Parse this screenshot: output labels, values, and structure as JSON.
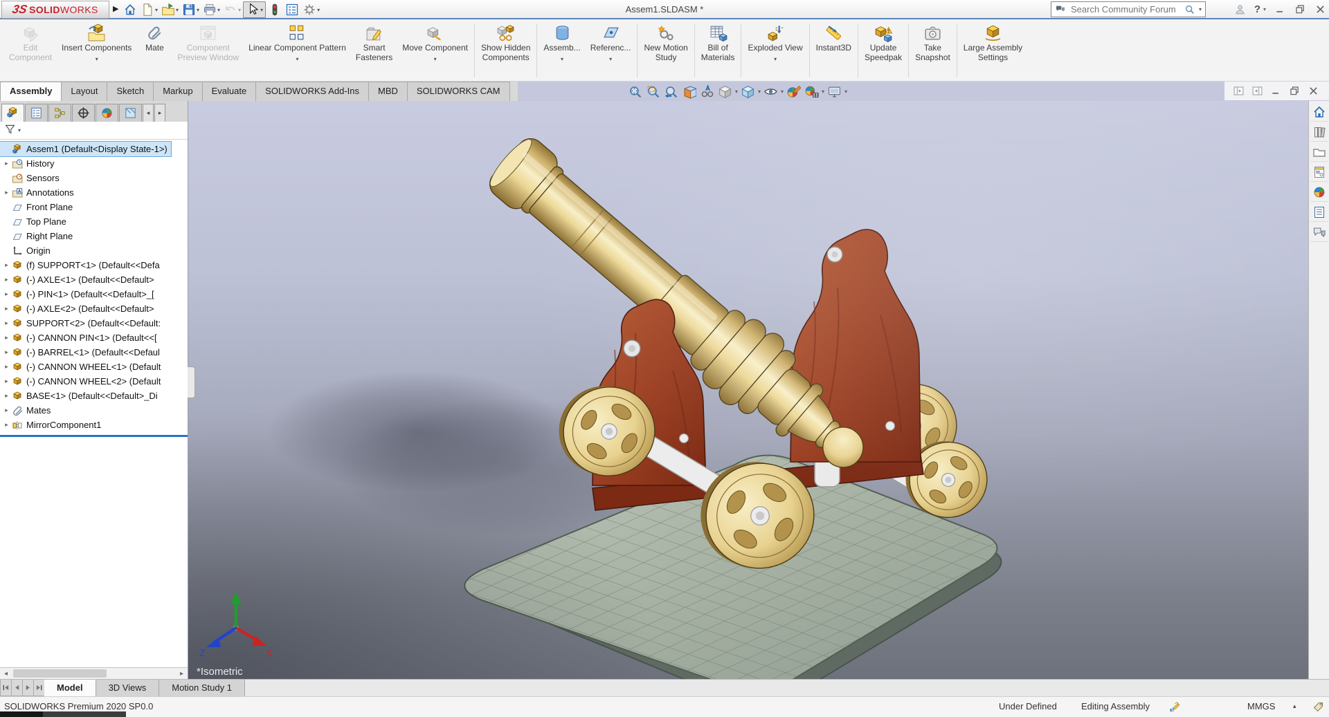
{
  "window": {
    "title": "Assem1.SLDASM *",
    "brand_prefix": "3S",
    "brand_bold": "SOLID",
    "brand_light": "WORKS"
  },
  "search": {
    "placeholder": "Search Community Forum"
  },
  "qat": {
    "buttons": [
      {
        "name": "home",
        "icon": "home"
      },
      {
        "name": "new-document",
        "icon": "new-doc",
        "dropdown": true
      },
      {
        "name": "open",
        "icon": "open-folder",
        "dropdown": true
      },
      {
        "name": "save",
        "icon": "save",
        "dropdown": true
      },
      {
        "name": "print",
        "icon": "print",
        "dropdown": true
      },
      {
        "name": "undo",
        "icon": "undo",
        "dropdown": true,
        "disabled": true
      },
      {
        "name": "select",
        "icon": "cursor",
        "dropdown": true,
        "boxed": true
      },
      {
        "name": "collaboration",
        "icon": "collab"
      },
      {
        "name": "task-list",
        "icon": "tasklist"
      },
      {
        "name": "options",
        "icon": "gear",
        "dropdown": true
      }
    ]
  },
  "ribbon": {
    "groups": [
      [
        {
          "name": "edit-component",
          "label": [
            "Edit",
            "Component"
          ],
          "icon": "edit-component",
          "disabled": true
        },
        {
          "name": "insert-components",
          "label": [
            "Insert Components"
          ],
          "icon": "insert-components",
          "dropdown": true
        },
        {
          "name": "mate",
          "label": [
            "Mate"
          ],
          "icon": "mate"
        },
        {
          "name": "component-preview-window",
          "label": [
            "Component",
            "Preview Window"
          ],
          "icon": "preview-window",
          "disabled": true
        },
        {
          "name": "linear-component-pattern",
          "label": [
            "Linear Component Pattern"
          ],
          "icon": "linear-pattern",
          "dropdown": true
        },
        {
          "name": "smart-fasteners",
          "label": [
            "Smart",
            "Fasteners"
          ],
          "icon": "smart-fasteners"
        },
        {
          "name": "move-component",
          "label": [
            "Move Component"
          ],
          "icon": "move-component",
          "dropdown": true
        }
      ],
      [
        {
          "name": "show-hidden-components",
          "label": [
            "Show Hidden",
            "Components"
          ],
          "icon": "show-hidden"
        }
      ],
      [
        {
          "name": "assembly-features",
          "label": [
            "Assemb..."
          ],
          "icon": "assembly-features",
          "dropdown": true
        },
        {
          "name": "reference-geometry",
          "label": [
            "Referenc..."
          ],
          "icon": "reference-geometry",
          "dropdown": true
        }
      ],
      [
        {
          "name": "new-motion-study",
          "label": [
            "New Motion",
            "Study"
          ],
          "icon": "motion-study"
        }
      ],
      [
        {
          "name": "bill-of-materials",
          "label": [
            "Bill of",
            "Materials"
          ],
          "icon": "bom"
        }
      ],
      [
        {
          "name": "exploded-view",
          "label": [
            "Exploded View"
          ],
          "icon": "exploded-view",
          "dropdown": true
        }
      ],
      [
        {
          "name": "instant3d",
          "label": [
            "Instant3D"
          ],
          "icon": "instant3d"
        }
      ],
      [
        {
          "name": "update-speedpak",
          "label": [
            "Update",
            "Speedpak"
          ],
          "icon": "update-speedpak"
        }
      ],
      [
        {
          "name": "take-snapshot",
          "label": [
            "Take",
            "Snapshot"
          ],
          "icon": "take-snapshot"
        }
      ],
      [
        {
          "name": "large-assembly-settings",
          "label": [
            "Large Assembly",
            "Settings"
          ],
          "icon": "large-assembly"
        }
      ]
    ]
  },
  "command_tabs": {
    "items": [
      "Assembly",
      "Layout",
      "Sketch",
      "Markup",
      "Evaluate",
      "SOLIDWORKS Add-Ins",
      "MBD",
      "SOLIDWORKS CAM"
    ],
    "active": "Assembly"
  },
  "headsup": {
    "buttons": [
      {
        "name": "zoom-to-fit",
        "icon": "hud-fit"
      },
      {
        "name": "zoom-to-area",
        "icon": "hud-area"
      },
      {
        "name": "previous-view",
        "icon": "hud-prev"
      },
      {
        "name": "section-view",
        "icon": "hud-section"
      },
      {
        "name": "annotation-views",
        "icon": "hud-annot"
      },
      {
        "name": "display-style",
        "icon": "hud-display",
        "dropdown": true
      },
      {
        "name": "view-orientation",
        "icon": "hud-cube",
        "dropdown": true
      },
      {
        "name": "hide-show-items",
        "icon": "hud-eye",
        "dropdown": true
      },
      {
        "name": "edit-appearance",
        "icon": "hud-appearance"
      },
      {
        "name": "apply-scene",
        "icon": "hud-scene",
        "dropdown": true
      },
      {
        "name": "view-settings",
        "icon": "hud-monitor",
        "dropdown": true
      }
    ]
  },
  "feature_manager": {
    "tabs": [
      {
        "name": "design-tree",
        "icon": "fm-tree",
        "active": true
      },
      {
        "name": "property-manager",
        "icon": "fm-props"
      },
      {
        "name": "configurations",
        "icon": "fm-config"
      },
      {
        "name": "dimxpert",
        "icon": "fm-dimx"
      },
      {
        "name": "display-manager",
        "icon": "fm-display"
      },
      {
        "name": "hidden-tab",
        "icon": "fm-extra"
      }
    ],
    "tree": [
      {
        "label": "Assem1  (Default<Display State-1>)",
        "icon": "t-assembly",
        "selected": true
      },
      {
        "label": "History",
        "icon": "t-history",
        "arrow": true
      },
      {
        "label": "Sensors",
        "icon": "t-sensors"
      },
      {
        "label": "Annotations",
        "icon": "t-annotations",
        "arrow": true
      },
      {
        "label": "Front Plane",
        "icon": "t-plane"
      },
      {
        "label": "Top Plane",
        "icon": "t-plane"
      },
      {
        "label": "Right Plane",
        "icon": "t-plane"
      },
      {
        "label": "Origin",
        "icon": "t-origin"
      },
      {
        "label": "(f) SUPPORT<1> (Default<<Defa",
        "icon": "t-part",
        "arrow": true
      },
      {
        "label": "(-) AXLE<1> (Default<<Default>",
        "icon": "t-part",
        "arrow": true
      },
      {
        "label": "(-) PIN<1> (Default<<Default>_[",
        "icon": "t-part",
        "arrow": true
      },
      {
        "label": "(-) AXLE<2> (Default<<Default>",
        "icon": "t-part",
        "arrow": true
      },
      {
        "label": "SUPPORT<2> (Default<<Default:",
        "icon": "t-part",
        "arrow": true
      },
      {
        "label": "(-) CANNON PIN<1> (Default<<[",
        "icon": "t-part",
        "arrow": true
      },
      {
        "label": "(-) BARREL<1> (Default<<Defaul",
        "icon": "t-part",
        "arrow": true
      },
      {
        "label": "(-) CANNON WHEEL<1> (Default",
        "icon": "t-part",
        "arrow": true
      },
      {
        "label": "(-) CANNON WHEEL<2> (Default",
        "icon": "t-part",
        "arrow": true
      },
      {
        "label": "BASE<1> (Default<<Default>_Di",
        "icon": "t-part",
        "arrow": true
      },
      {
        "label": "Mates",
        "icon": "t-mates",
        "arrow": true
      },
      {
        "label": "MirrorComponent1",
        "icon": "t-mirror",
        "arrow": true
      }
    ]
  },
  "viewport": {
    "view_label": "*Isometric",
    "triad": {
      "x": "X",
      "z": "Z"
    }
  },
  "task_pane": {
    "buttons": [
      {
        "name": "home",
        "icon": "tp-home"
      },
      {
        "name": "design-library",
        "icon": "tp-library"
      },
      {
        "name": "file-explorer",
        "icon": "tp-explorer"
      },
      {
        "name": "view-palette",
        "icon": "tp-palette"
      },
      {
        "name": "appearances-scenes",
        "icon": "tp-appear"
      },
      {
        "name": "custom-properties",
        "icon": "tp-props"
      },
      {
        "name": "solidworks-forum",
        "icon": "tp-forum"
      }
    ]
  },
  "document_tabs": {
    "items": [
      "Model",
      "3D Views",
      "Motion Study 1"
    ],
    "active": "Model"
  },
  "status_bar": {
    "product": "SOLIDWORKS Premium 2020 SP0.0",
    "define_state": "Under Defined",
    "mode": "Editing Assembly",
    "units": "MMGS"
  },
  "colors": {
    "brand_red": "#c8202c",
    "selection": "#cde5f7",
    "rollback_bar": "#2a72c8",
    "viewport_top": "#c9cce0",
    "viewport_bottom": "#6d717b",
    "brass": "#e8d290",
    "wood": "#9c3f22",
    "base_stone": "#a4aea1"
  }
}
